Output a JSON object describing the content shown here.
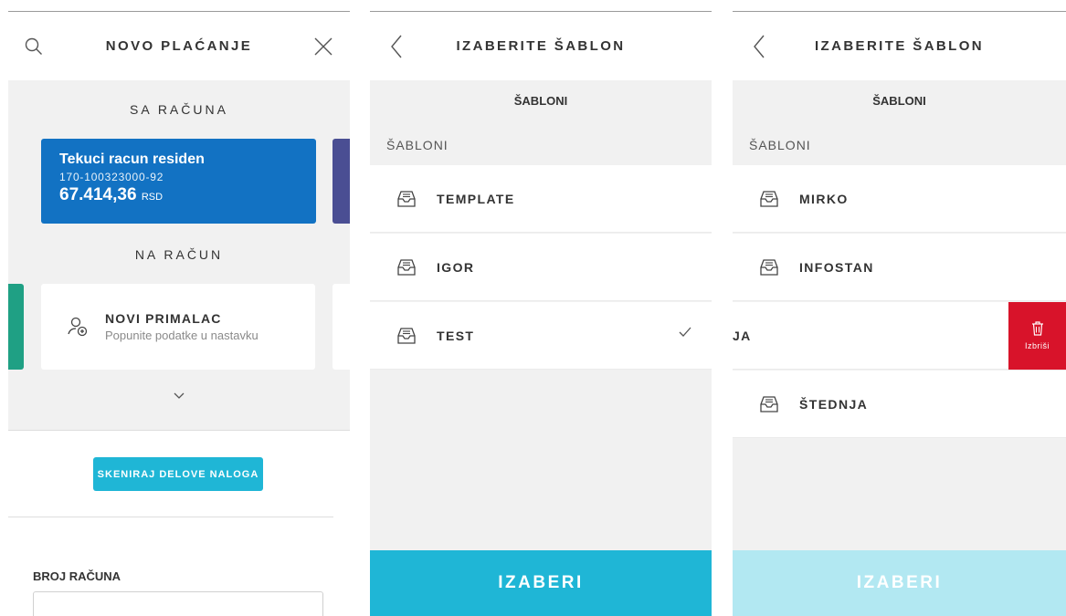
{
  "colors": {
    "accent": "#1fb6d6",
    "accent_disabled": "#b2e8f2",
    "account_blue": "#1272c3",
    "account_purple": "#4a4e93",
    "green": "#1fa084",
    "delete_red": "#d8132a"
  },
  "screen1": {
    "title": "NOVO PLAĆANJE",
    "from_section": "SA RAČUNA",
    "account": {
      "name": "Tekuci racun residen",
      "number": "170-100323000-92",
      "balance": "67.414,36",
      "currency": "RSD"
    },
    "to_section": "NA RAČUN",
    "new_recipient": {
      "title": "NOVI PRIMALAC",
      "subtitle": "Popunite podatke u nastavku"
    },
    "scan_button": "SKENIRAJ DELOVE NALOGA",
    "account_number_label": "BROJ RAČUNA",
    "icons": [
      "search-icon",
      "close-icon",
      "add-person-icon",
      "chevron-down-icon"
    ]
  },
  "screen2": {
    "title": "IZABERITE ŠABLON",
    "section_title": "ŠABLONI",
    "list_label": "ŠABLONI",
    "items": [
      {
        "label": "TEMPLATE"
      },
      {
        "label": "IGOR"
      },
      {
        "label": "TEST",
        "selected": true
      }
    ],
    "select_button": "IZABERI"
  },
  "screen3": {
    "title": "IZABERITE ŠABLON",
    "section_title": "ŠABLONI",
    "list_label": "ŠABLONI",
    "items": [
      {
        "label": "MIRKO"
      },
      {
        "label": "INFOSTAN"
      },
      {
        "label": "JA",
        "swiped": true
      },
      {
        "label": "ŠTEDNJA"
      }
    ],
    "delete_label": "Izbriši",
    "select_button": "IZABERI",
    "select_button_state": "disabled"
  }
}
